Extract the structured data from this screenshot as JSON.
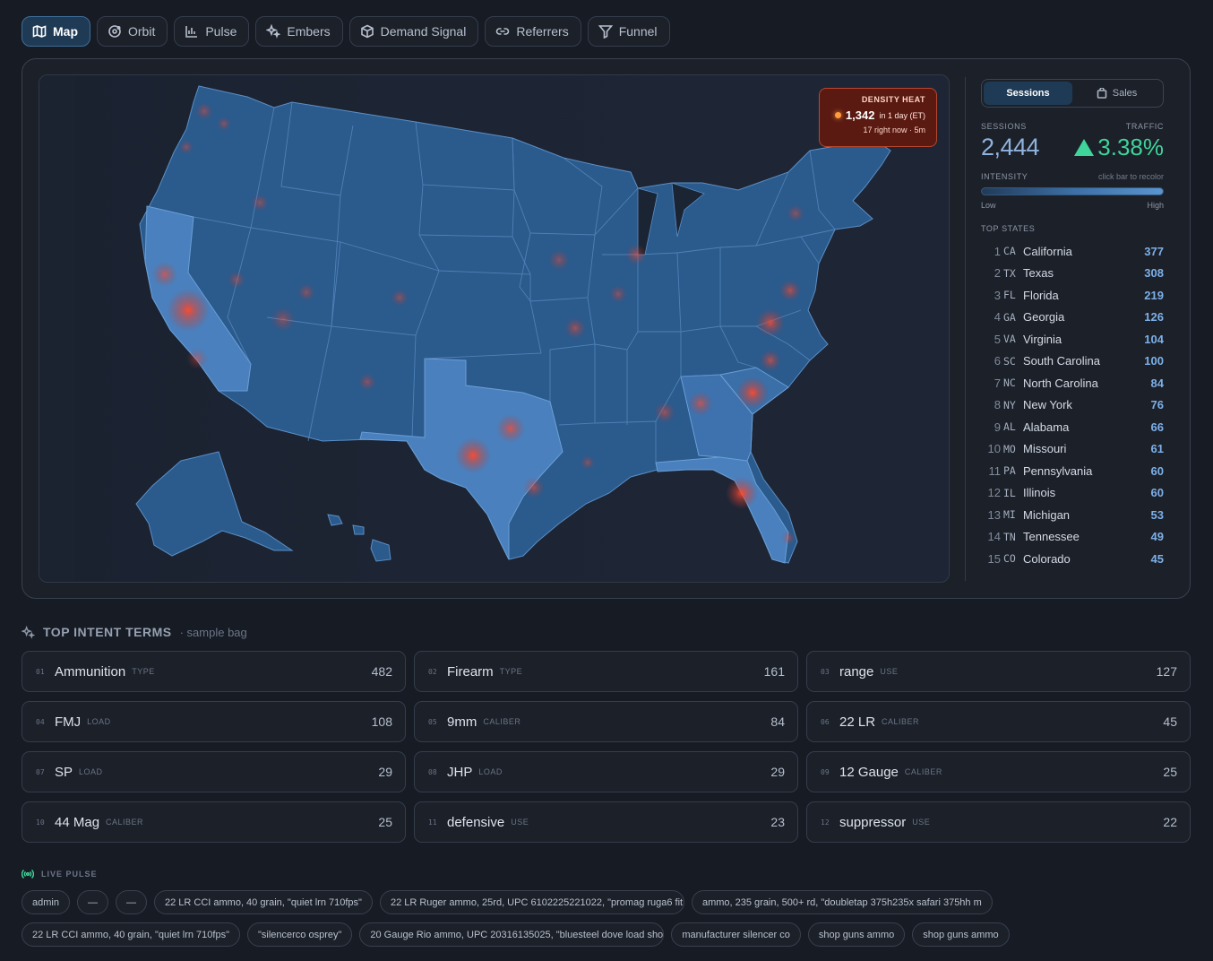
{
  "tabs": [
    {
      "label": "Map",
      "icon": "map-icon",
      "active": true
    },
    {
      "label": "Orbit",
      "icon": "orbit-icon"
    },
    {
      "label": "Pulse",
      "icon": "bar-chart-icon"
    },
    {
      "label": "Embers",
      "icon": "sparkles-icon"
    },
    {
      "label": "Demand Signal",
      "icon": "cube-icon"
    },
    {
      "label": "Referrers",
      "icon": "link-icon"
    },
    {
      "label": "Funnel",
      "icon": "funnel-icon"
    }
  ],
  "heat": {
    "title": "DENSITY HEAT",
    "value": "1,342",
    "window": "in 1 day (ET)",
    "sub": "17 right now · 5m",
    "color": "#ff9b3b"
  },
  "side": {
    "toggle": {
      "sessions": "Sessions",
      "sales": "Sales"
    },
    "sessions_label": "SESSIONS",
    "traffic_label": "TRAFFIC",
    "sessions_value": "2,444",
    "traffic_value": "3.38%",
    "intensity_label": "INTENSITY",
    "intensity_hint": "click bar to recolor",
    "low": "Low",
    "high": "High",
    "top_states_label": "TOP STATES",
    "accent": "#3ed49a"
  },
  "states": [
    {
      "rank": "1",
      "code": "CA",
      "name": "California",
      "value": "377"
    },
    {
      "rank": "2",
      "code": "TX",
      "name": "Texas",
      "value": "308"
    },
    {
      "rank": "3",
      "code": "FL",
      "name": "Florida",
      "value": "219"
    },
    {
      "rank": "4",
      "code": "GA",
      "name": "Georgia",
      "value": "126"
    },
    {
      "rank": "5",
      "code": "VA",
      "name": "Virginia",
      "value": "104"
    },
    {
      "rank": "6",
      "code": "SC",
      "name": "South Carolina",
      "value": "100"
    },
    {
      "rank": "7",
      "code": "NC",
      "name": "North Carolina",
      "value": "84"
    },
    {
      "rank": "8",
      "code": "NY",
      "name": "New York",
      "value": "76"
    },
    {
      "rank": "9",
      "code": "AL",
      "name": "Alabama",
      "value": "66"
    },
    {
      "rank": "10",
      "code": "MO",
      "name": "Missouri",
      "value": "61"
    },
    {
      "rank": "11",
      "code": "PA",
      "name": "Pennsylvania",
      "value": "60"
    },
    {
      "rank": "12",
      "code": "IL",
      "name": "Illinois",
      "value": "60"
    },
    {
      "rank": "13",
      "code": "MI",
      "name": "Michigan",
      "value": "53"
    },
    {
      "rank": "14",
      "code": "TN",
      "name": "Tennessee",
      "value": "49"
    },
    {
      "rank": "15",
      "code": "CO",
      "name": "Colorado",
      "value": "45"
    }
  ],
  "intent": {
    "title": "TOP INTENT TERMS",
    "subtitle": "· sample bag",
    "terms": [
      {
        "idx": "01",
        "name": "Ammunition",
        "cat": "TYPE",
        "count": "482"
      },
      {
        "idx": "02",
        "name": "Firearm",
        "cat": "TYPE",
        "count": "161"
      },
      {
        "idx": "03",
        "name": "range",
        "cat": "USE",
        "count": "127"
      },
      {
        "idx": "04",
        "name": "FMJ",
        "cat": "LOAD",
        "count": "108"
      },
      {
        "idx": "05",
        "name": "9mm",
        "cat": "CALIBER",
        "count": "84"
      },
      {
        "idx": "06",
        "name": "22 LR",
        "cat": "CALIBER",
        "count": "45"
      },
      {
        "idx": "07",
        "name": "SP",
        "cat": "LOAD",
        "count": "29"
      },
      {
        "idx": "08",
        "name": "JHP",
        "cat": "LOAD",
        "count": "29"
      },
      {
        "idx": "09",
        "name": "12 Gauge",
        "cat": "CALIBER",
        "count": "25"
      },
      {
        "idx": "10",
        "name": "44 Mag",
        "cat": "CALIBER",
        "count": "25"
      },
      {
        "idx": "11",
        "name": "defensive",
        "cat": "USE",
        "count": "23"
      },
      {
        "idx": "12",
        "name": "suppressor",
        "cat": "USE",
        "count": "22"
      }
    ]
  },
  "pulse": {
    "title": "LIVE PULSE",
    "chips": [
      "admin",
      "—",
      "—",
      "22 LR CCI ammo, 40 grain, \"quiet lrn 710fps\"",
      "22 LR Ruger ammo, 25rd, UPC 6102225221022, \"promag ruga6 fit",
      "ammo, 235 grain, 500+ rd, \"doubletap 375h235x safari 375hh m",
      "22 LR CCI ammo, 40 grain, \"quiet lrn 710fps\"",
      "\"silencerco osprey\"",
      "20 Gauge Rio ammo, UPC 20316135025, \"bluesteel dove load sho",
      "manufacturer silencer co",
      "shop guns ammo",
      "shop guns ammo"
    ]
  }
}
